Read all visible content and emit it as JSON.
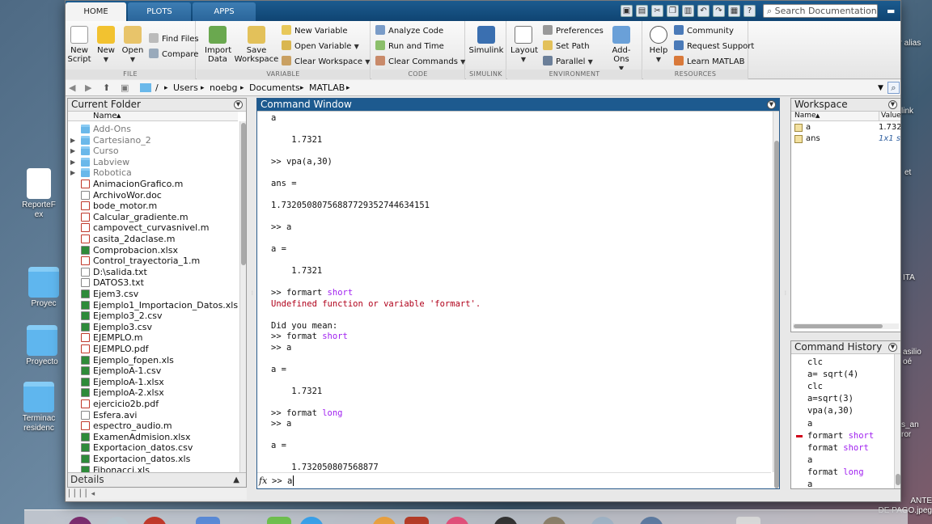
{
  "desktop": {
    "left_icons": [
      {
        "label": "ReporteF",
        "label2": "ex"
      },
      {
        "label": "Proyec",
        "label2": ""
      },
      {
        "label": "Proyecto",
        "label2": ""
      },
      {
        "label": "Terminac",
        "label2": "residenc"
      }
    ],
    "right_icons": [
      {
        "label": "er alias"
      },
      {
        "label": "link"
      },
      {
        "label": "et"
      },
      {
        "label": "ITA"
      },
      {
        "label": "asilio",
        "label2": "oé"
      },
      {
        "label": "s_an",
        "label2": "ror"
      },
      {
        "label": "ANTE",
        "label2": "DE PAGO.jpeg"
      }
    ]
  },
  "tabs": [
    "HOME",
    "PLOTS",
    "APPS"
  ],
  "search": {
    "placeholder": "Search Documentation"
  },
  "ribbon": {
    "file": {
      "label": "FILE",
      "new_script": [
        "New",
        "Script"
      ],
      "new": "New",
      "open": "Open",
      "find_files": "Find Files",
      "compare": "Compare"
    },
    "variable": {
      "label": "VARIABLE",
      "import_data": [
        "Import",
        "Data"
      ],
      "save_workspace": [
        "Save",
        "Workspace"
      ],
      "new_variable": "New Variable",
      "open_variable": "Open Variable",
      "clear_workspace": "Clear Workspace"
    },
    "code": {
      "label": "CODE",
      "analyze_code": "Analyze Code",
      "run_and_time": "Run and Time",
      "clear_commands": "Clear Commands"
    },
    "simulink": {
      "label": "SIMULINK",
      "btn": "Simulink"
    },
    "environment": {
      "label": "ENVIRONMENT",
      "layout": "Layout",
      "preferences": "Preferences",
      "set_path": "Set Path",
      "parallel": "Parallel",
      "add_ons": "Add-Ons"
    },
    "resources": {
      "label": "RESOURCES",
      "help": "Help",
      "community": "Community",
      "request_support": "Request Support",
      "learn_matlab": "Learn MATLAB"
    }
  },
  "address": [
    "/",
    "Users",
    "noebg",
    "Documents",
    "MATLAB"
  ],
  "current_folder": {
    "title": "Current Folder",
    "col_name": "Name",
    "sort_arrow": "▲",
    "files": [
      {
        "name": "Add-Ons",
        "kind": "folder",
        "tw": ""
      },
      {
        "name": "Cartesiano_2",
        "kind": "folder",
        "tw": "▶"
      },
      {
        "name": "Curso",
        "kind": "folder",
        "tw": "▶"
      },
      {
        "name": "Labview",
        "kind": "folder",
        "tw": "▶"
      },
      {
        "name": "Robotica",
        "kind": "folder",
        "tw": "▶"
      },
      {
        "name": "AnimacionGrafico.m",
        "kind": "m",
        "tw": ""
      },
      {
        "name": "ArchivoWor.doc",
        "kind": "doc",
        "tw": ""
      },
      {
        "name": "bode_motor.m",
        "kind": "m",
        "tw": ""
      },
      {
        "name": "Calcular_gradiente.m",
        "kind": "m",
        "tw": ""
      },
      {
        "name": "campovect_curvasnivel.m",
        "kind": "m",
        "tw": ""
      },
      {
        "name": "casita_2daclase.m",
        "kind": "m",
        "tw": ""
      },
      {
        "name": "Comprobacion.xlsx",
        "kind": "xls",
        "tw": ""
      },
      {
        "name": "Control_trayectoria_1.m",
        "kind": "m",
        "tw": ""
      },
      {
        "name": "D:\\salida.txt",
        "kind": "txt",
        "tw": ""
      },
      {
        "name": "DATOS3.txt",
        "kind": "txt",
        "tw": ""
      },
      {
        "name": "Ejem3.csv",
        "kind": "xls",
        "tw": ""
      },
      {
        "name": "Ejemplo1_Importacion_Datos.xlsx",
        "kind": "xls",
        "tw": ""
      },
      {
        "name": "Ejemplo3_2.csv",
        "kind": "xls",
        "tw": ""
      },
      {
        "name": "Ejemplo3.csv",
        "kind": "xls",
        "tw": ""
      },
      {
        "name": "EJEMPLO.m",
        "kind": "m",
        "tw": ""
      },
      {
        "name": "EJEMPLO.pdf",
        "kind": "pdf",
        "tw": ""
      },
      {
        "name": "Ejemplo_fopen.xls",
        "kind": "xls",
        "tw": ""
      },
      {
        "name": "EjemploA-1.csv",
        "kind": "xls",
        "tw": ""
      },
      {
        "name": "EjemploA-1.xlsx",
        "kind": "xls",
        "tw": ""
      },
      {
        "name": "EjemploA-2.xlsx",
        "kind": "xls",
        "tw": ""
      },
      {
        "name": "ejercicio2b.pdf",
        "kind": "pdf",
        "tw": ""
      },
      {
        "name": "Esfera.avi",
        "kind": "avi",
        "tw": ""
      },
      {
        "name": "espectro_audio.m",
        "kind": "m",
        "tw": ""
      },
      {
        "name": "ExamenAdmision.xlsx",
        "kind": "xls",
        "tw": ""
      },
      {
        "name": "Exportacion_datos.csv",
        "kind": "xls",
        "tw": ""
      },
      {
        "name": "Exportacion_datos.xls",
        "kind": "xls",
        "tw": ""
      },
      {
        "name": "Fibonacci.xls",
        "kind": "xls",
        "tw": ""
      }
    ],
    "details": "Details"
  },
  "command_window": {
    "title": "Command Window",
    "lines": [
      {
        "y": 0,
        "text": "a"
      },
      {
        "y": 2,
        "text": "    1.7321"
      },
      {
        "y": 4,
        "text": ">> vpa(a,30)"
      },
      {
        "y": 6,
        "text": "ans ="
      },
      {
        "y": 8,
        "text": "1.73205080756887729352744634151"
      },
      {
        "y": 10,
        "text": ">> a"
      },
      {
        "y": 12,
        "text": "a ="
      },
      {
        "y": 14,
        "text": "    1.7321"
      },
      {
        "y": 16,
        "text": ">> formart ",
        "kw": "short"
      },
      {
        "y": 17,
        "text": "Undefined function or variable 'formart'.",
        "err": true
      },
      {
        "y": 19,
        "text": "Did you mean:"
      },
      {
        "y": 20,
        "text": ">> format ",
        "kw": "short"
      },
      {
        "y": 21,
        "text": ">> a"
      },
      {
        "y": 23,
        "text": "a ="
      },
      {
        "y": 25,
        "text": "    1.7321"
      },
      {
        "y": 27,
        "text": ">> format ",
        "kw": "long"
      },
      {
        "y": 28,
        "text": ">> a"
      },
      {
        "y": 30,
        "text": "a ="
      },
      {
        "y": 32,
        "text": "    1.732050807568877"
      }
    ],
    "fx": "fx",
    "prompt": ">> a"
  },
  "workspace": {
    "title": "Workspace",
    "col_name": "Name",
    "sort_arrow": "▲",
    "col_value": "Value",
    "vars": [
      {
        "name": "a",
        "value": "1.732"
      },
      {
        "name": "ans",
        "value": "1x1 s"
      }
    ]
  },
  "history": {
    "title": "Command History",
    "items": [
      {
        "text": "clc"
      },
      {
        "text": "a= sqrt(4)"
      },
      {
        "text": "clc"
      },
      {
        "text": "a=sqrt(3)"
      },
      {
        "text": "vpa(a,30)"
      },
      {
        "text": "a"
      },
      {
        "text": "formart ",
        "kw": "short",
        "error": true
      },
      {
        "text": "format ",
        "kw": "short"
      },
      {
        "text": "a"
      },
      {
        "text": "format ",
        "kw": "long"
      },
      {
        "text": "a"
      }
    ]
  },
  "colors": {
    "titlebar": "#1d5a8f",
    "keyword": "#a020f0",
    "error": "#b0001a",
    "folder": "#6ab8ea"
  }
}
